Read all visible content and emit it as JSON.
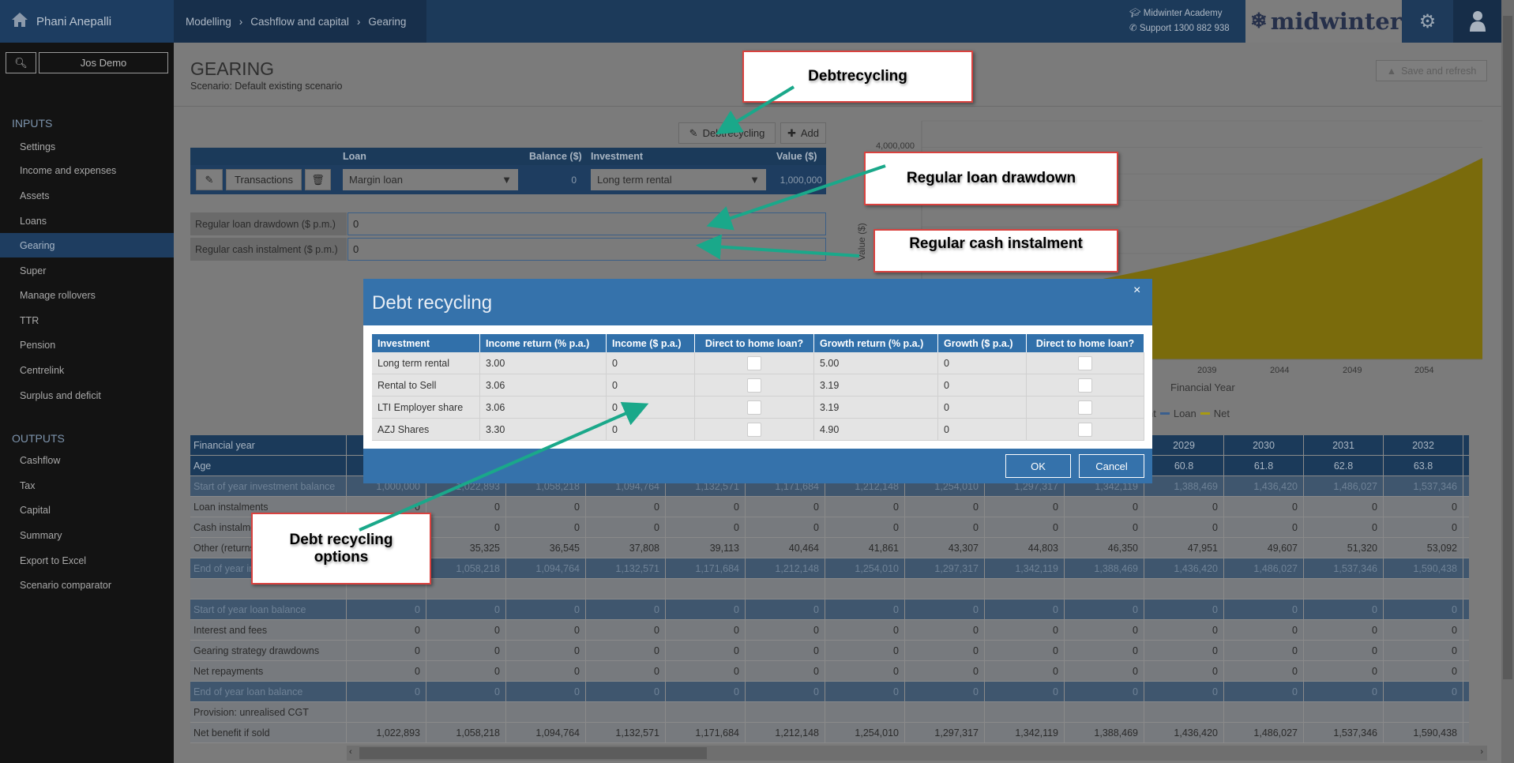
{
  "header": {
    "user": "Phani Anepalli",
    "breadcrumbs": [
      "Modelling",
      "Cashflow and capital",
      "Gearing"
    ],
    "academy": "Midwinter Academy",
    "support": "Support 1300 882 938",
    "logo_text": "midwinter"
  },
  "sidebar": {
    "client": "Jos Demo",
    "inputs_label": "INPUTS",
    "inputs": [
      "Settings",
      "Income and expenses",
      "Assets",
      "Loans",
      "Gearing",
      "Super",
      "Manage rollovers",
      "TTR",
      "Pension",
      "Centrelink",
      "Surplus and deficit"
    ],
    "active": "Gearing",
    "outputs_label": "OUTPUTS",
    "outputs": [
      "Cashflow",
      "Tax",
      "Capital",
      "Summary",
      "Export to Excel",
      "Scenario comparator"
    ]
  },
  "page": {
    "title": "GEARING",
    "scenario": "Scenario: Default existing scenario",
    "save_refresh": "Save and refresh",
    "debtrecycling_btn": "Debtrecycling",
    "add_btn": "Add"
  },
  "loan_table": {
    "headers": {
      "loan": "Loan",
      "balance": "Balance ($)",
      "investment": "Investment",
      "value": "Value ($)"
    },
    "transactions": "Transactions",
    "loan": "Margin loan",
    "balance": "0",
    "investment": "Long term rental",
    "value": "1,000,000"
  },
  "fields": {
    "drawdown_label": "Regular loan drawdown ($ p.m.)",
    "drawdown_value": "0",
    "instalment_label": "Regular cash instalment ($ p.m.)",
    "instalment_value": "0"
  },
  "chart_data": {
    "type": "area",
    "ylabel": "Value ($)",
    "xlabel": "Financial Year",
    "y_tick_labels": [
      "4,000,000"
    ],
    "x_tick_labels": [
      "2039",
      "2044",
      "2049",
      "2054"
    ],
    "ylim": [
      0,
      4500000
    ],
    "xlim": [
      2019,
      2058
    ],
    "legend": [
      "nt",
      "Loan",
      "Net"
    ],
    "legend_position": "bottom",
    "colors": {
      "Loan": "#3a5f8e",
      "Net": "#7a6b0c"
    },
    "series": [
      {
        "name": "Net",
        "x": [
          2019,
          2024,
          2029,
          2034,
          2039,
          2044,
          2049,
          2054,
          2058
        ],
        "values": [
          1000000,
          1190000,
          1390000,
          1650000,
          1960000,
          2330000,
          2770000,
          3290000,
          3800000
        ]
      }
    ]
  },
  "results": {
    "rows": [
      {
        "label": "Financial year",
        "style": "dark",
        "values": [
          "",
          "",
          "",
          "",
          "",
          "",
          "",
          "",
          "",
          "",
          "2029",
          "2030",
          "2031",
          "2032"
        ]
      },
      {
        "label": "Age",
        "style": "dark",
        "values": [
          "",
          "",
          "",
          "",
          "",
          "",
          "",
          "",
          "",
          "",
          "60.8",
          "61.8",
          "62.8",
          "63.8"
        ]
      },
      {
        "label": "Start of year investment balance",
        "style": "mid",
        "values": [
          "1,000,000",
          "1,022,893",
          "1,058,218",
          "1,094,764",
          "1,132,571",
          "1,171,684",
          "1,212,148",
          "1,254,010",
          "1,297,317",
          "1,342,119",
          "1,388,469",
          "1,436,420",
          "1,486,027",
          "1,537,346"
        ]
      },
      {
        "label": "Loan instalments",
        "style": "plain",
        "values": [
          "0",
          "0",
          "0",
          "0",
          "0",
          "0",
          "0",
          "0",
          "0",
          "0",
          "0",
          "0",
          "0",
          "0"
        ]
      },
      {
        "label": "Cash instalments",
        "style": "plain",
        "values": [
          "",
          "0",
          "0",
          "0",
          "0",
          "0",
          "0",
          "0",
          "0",
          "0",
          "0",
          "0",
          "0",
          "0"
        ]
      },
      {
        "label": "Other (returns)",
        "style": "plain",
        "values": [
          "",
          "35,325",
          "36,545",
          "37,808",
          "39,113",
          "40,464",
          "41,861",
          "43,307",
          "44,803",
          "46,350",
          "47,951",
          "49,607",
          "51,320",
          "53,092"
        ]
      },
      {
        "label": "End of year investment balance",
        "style": "mid",
        "values": [
          "",
          "1,058,218",
          "1,094,764",
          "1,132,571",
          "1,171,684",
          "1,212,148",
          "1,254,010",
          "1,297,317",
          "1,342,119",
          "1,388,469",
          "1,436,420",
          "1,486,027",
          "1,537,346",
          "1,590,438"
        ]
      },
      {
        "label": "",
        "style": "plain",
        "values": [
          "",
          "",
          "",
          "",
          "",
          "",
          "",
          "",
          "",
          "",
          "",
          "",
          "",
          ""
        ]
      },
      {
        "label": "Start of year loan balance",
        "style": "mid",
        "values": [
          "0",
          "0",
          "0",
          "0",
          "0",
          "0",
          "0",
          "0",
          "0",
          "0",
          "0",
          "0",
          "0",
          "0"
        ]
      },
      {
        "label": "Interest and fees",
        "style": "plain",
        "values": [
          "0",
          "0",
          "0",
          "0",
          "0",
          "0",
          "0",
          "0",
          "0",
          "0",
          "0",
          "0",
          "0",
          "0"
        ]
      },
      {
        "label": "Gearing strategy drawdowns",
        "style": "plain",
        "values": [
          "0",
          "0",
          "0",
          "0",
          "0",
          "0",
          "0",
          "0",
          "0",
          "0",
          "0",
          "0",
          "0",
          "0"
        ]
      },
      {
        "label": "Net repayments",
        "style": "plain",
        "values": [
          "0",
          "0",
          "0",
          "0",
          "0",
          "0",
          "0",
          "0",
          "0",
          "0",
          "0",
          "0",
          "0",
          "0"
        ]
      },
      {
        "label": "End of year loan balance",
        "style": "mid",
        "values": [
          "0",
          "0",
          "0",
          "0",
          "0",
          "0",
          "0",
          "0",
          "0",
          "0",
          "0",
          "0",
          "0",
          "0"
        ]
      },
      {
        "label": "Provision: unrealised CGT",
        "style": "plain",
        "values": [
          "",
          "",
          "",
          "",
          "",
          "",
          "",
          "",
          "",
          "",
          "",
          "",
          "",
          ""
        ]
      },
      {
        "label": "Net benefit if sold",
        "style": "plain",
        "values": [
          "1,022,893",
          "1,058,218",
          "1,094,764",
          "1,132,571",
          "1,171,684",
          "1,212,148",
          "1,254,010",
          "1,297,317",
          "1,342,119",
          "1,388,469",
          "1,436,420",
          "1,486,027",
          "1,537,346",
          "1,590,438"
        ]
      }
    ]
  },
  "modal": {
    "title": "Debt recycling",
    "close": "×",
    "headers": [
      "Investment",
      "Income return (% p.a.)",
      "Income ($ p.a.)",
      "Direct to home loan?",
      "Growth return (% p.a.)",
      "Growth ($ p.a.)",
      "Direct to home loan?"
    ],
    "rows": [
      {
        "investment": "Long term rental",
        "income_return": "3.00",
        "income": "0",
        "income_direct": false,
        "growth_return": "5.00",
        "growth": "0",
        "growth_direct": false
      },
      {
        "investment": "Rental to Sell",
        "income_return": "3.06",
        "income": "0",
        "income_direct": false,
        "growth_return": "3.19",
        "growth": "0",
        "growth_direct": false
      },
      {
        "investment": "LTI Employer share",
        "income_return": "3.06",
        "income": "0",
        "income_direct": false,
        "growth_return": "3.19",
        "growth": "0",
        "growth_direct": false
      },
      {
        "investment": "AZJ Shares",
        "income_return": "3.30",
        "income": "0",
        "income_direct": false,
        "growth_return": "4.90",
        "growth": "0",
        "growth_direct": false
      }
    ],
    "ok": "OK",
    "cancel": "Cancel"
  },
  "callouts": {
    "debtrecycling": "Debtrecycling",
    "drawdown": "Regular loan drawdown",
    "instalment": "Regular cash instalment",
    "options": "Debt recycling options"
  },
  "colors": {
    "arrow": "#1aa88a",
    "callout_border": "#d9423f",
    "modal": "#3572ab"
  }
}
